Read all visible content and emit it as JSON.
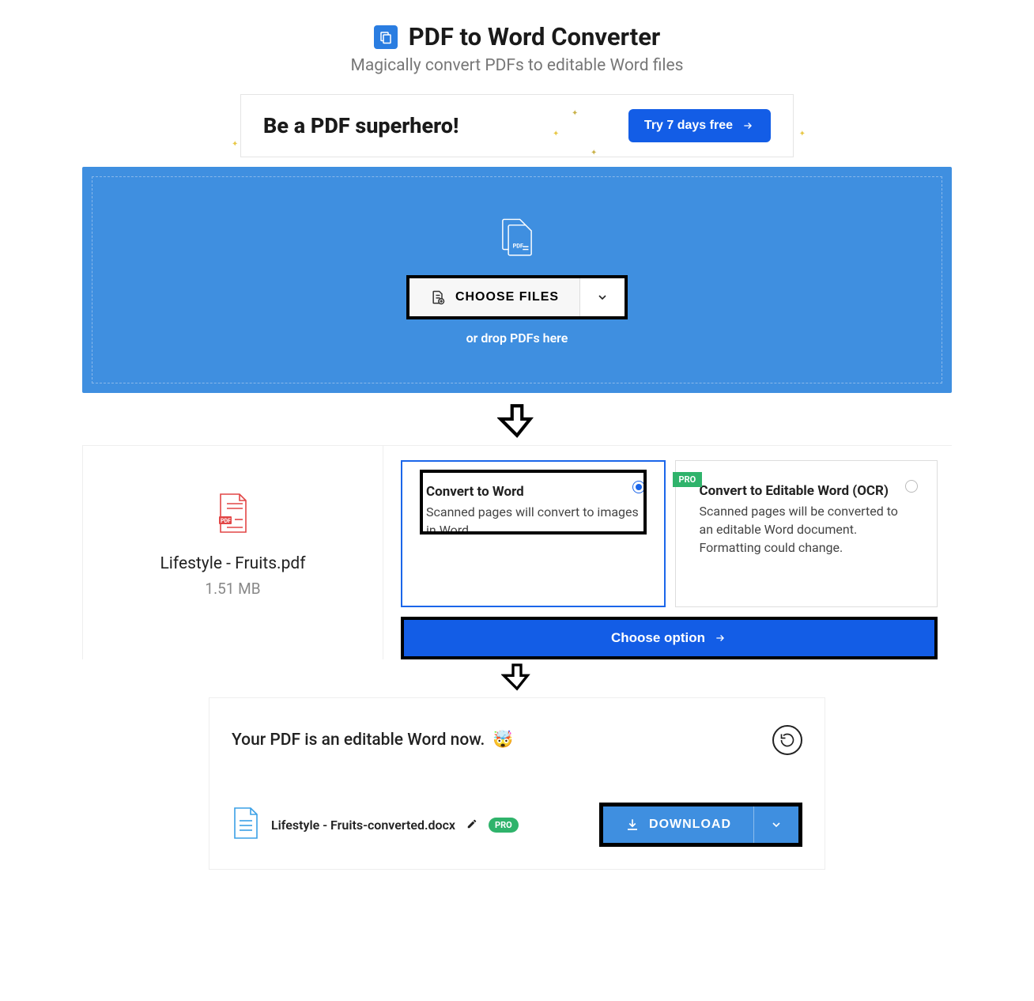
{
  "header": {
    "title": "PDF to Word Converter",
    "subtitle": "Magically convert PDFs to editable Word files"
  },
  "promo": {
    "title": "Be a PDF superhero!",
    "cta_label": "Try 7 days free"
  },
  "dropzone": {
    "choose_label": "CHOOSE FILES",
    "hint": "or drop PDFs here"
  },
  "file": {
    "name": "Lifestyle - Fruits.pdf",
    "size": "1.51 MB"
  },
  "options": {
    "a": {
      "title": "Convert to Word",
      "desc": "Scanned pages will convert to images in Word."
    },
    "b": {
      "title": "Convert to Editable Word (OCR)",
      "desc": "Scanned pages will be converted to an editable Word document. Formatting could change.",
      "badge": "PRO"
    },
    "cta": "Choose option"
  },
  "result": {
    "message": "Your PDF is an editable Word now.",
    "filename": "Lifestyle - Fruits-converted.docx",
    "pro": "PRO",
    "download": "DOWNLOAD"
  }
}
